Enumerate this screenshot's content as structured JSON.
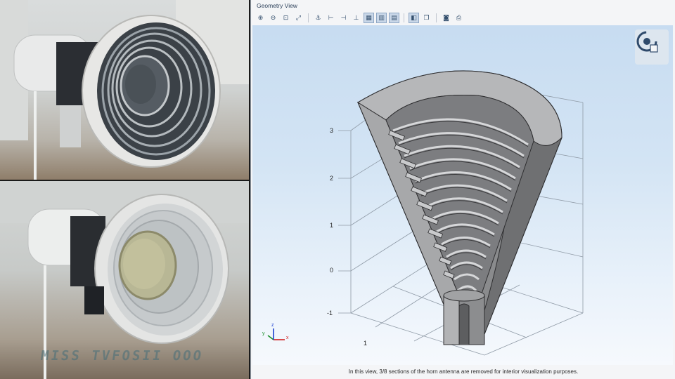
{
  "window": {
    "title": "Geometry View"
  },
  "toolbar": {
    "buttons": [
      {
        "icon": "zoom-in-icon",
        "glyph": "⊕",
        "active": false
      },
      {
        "icon": "zoom-out-icon",
        "glyph": "⊖",
        "active": false
      },
      {
        "icon": "zoom-box-icon",
        "glyph": "⊡",
        "active": false
      },
      {
        "icon": "zoom-extents-icon",
        "glyph": "⤢",
        "active": false
      },
      {
        "icon": "anchor-icon",
        "glyph": "⚓",
        "active": false
      },
      {
        "icon": "xy-view-icon",
        "glyph": "⊢",
        "active": false
      },
      {
        "icon": "yz-view-icon",
        "glyph": "⊣",
        "active": false
      },
      {
        "icon": "zx-view-icon",
        "glyph": "⊥",
        "active": false
      },
      {
        "icon": "render-wireframe-icon",
        "glyph": "▦",
        "active": true
      },
      {
        "icon": "render-transparency-icon",
        "glyph": "▥",
        "active": true
      },
      {
        "icon": "render-scene-light-icon",
        "glyph": "▤",
        "active": true
      },
      {
        "icon": "view-settings-icon",
        "glyph": "◧",
        "active": true
      },
      {
        "icon": "copy-view-icon",
        "glyph": "❐",
        "active": false
      },
      {
        "icon": "camera-icon",
        "glyph": "◙",
        "active": false
      },
      {
        "icon": "print-icon",
        "glyph": "⎙",
        "active": false
      }
    ]
  },
  "axis": {
    "z_ticks": [
      "3",
      "2",
      "1",
      "0",
      "-1"
    ],
    "y_tick": "1",
    "triad": {
      "x": "x",
      "y": "y",
      "z": "z"
    }
  },
  "caption": "In this view, 3/8 sections of the horn antenna are removed for interior visualization purposes.",
  "photos": {
    "watermark": "MISS TVFOSII OOO"
  },
  "colors": {
    "viewport_top": "#c7dcf1",
    "metal_dark": "#6d6d6f",
    "metal_light": "#b9babc",
    "triad_x": "#d02020",
    "triad_y": "#1a8f2a",
    "triad_z": "#1b3fd0"
  }
}
